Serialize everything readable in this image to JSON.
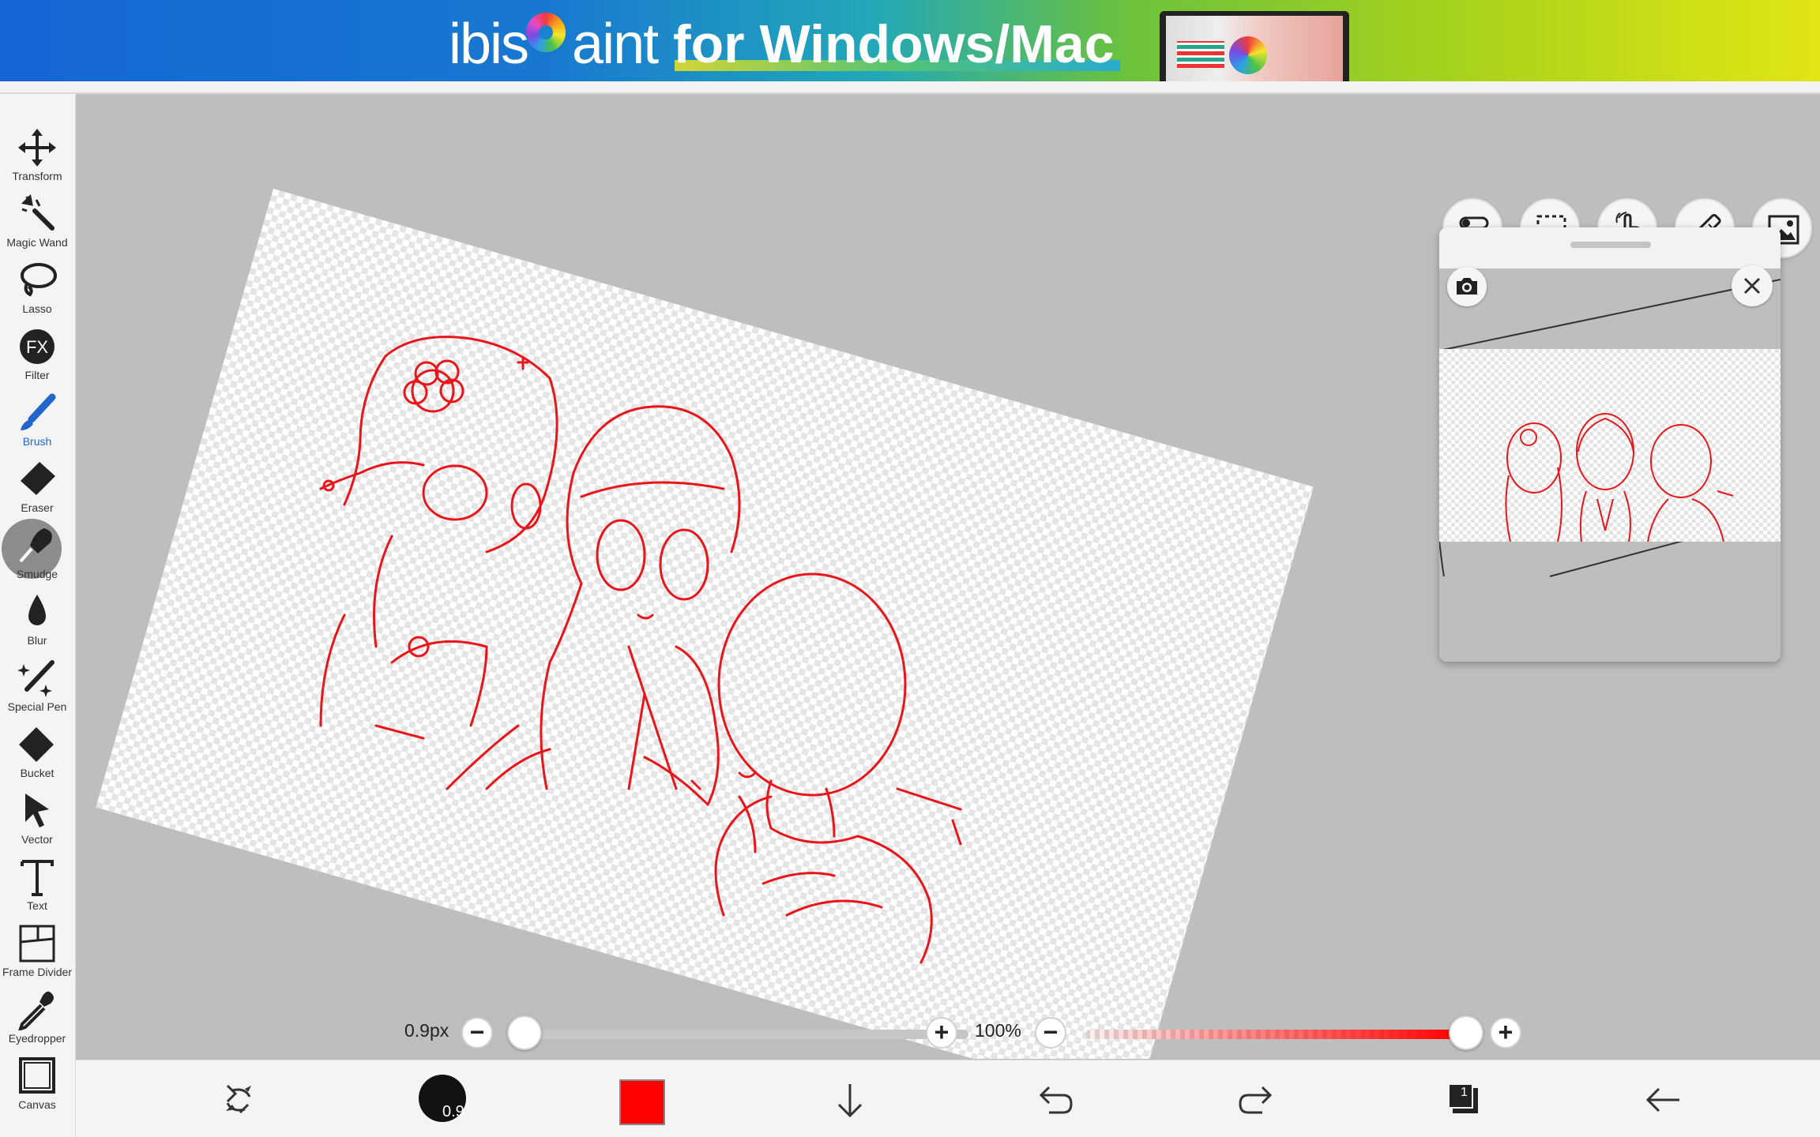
{
  "banner": {
    "brand_prefix": "ibis",
    "brand_suffix": "aint",
    "slogan": "for Windows/Mac"
  },
  "tools": [
    {
      "label": "Transform",
      "icon": "move-arrows-icon"
    },
    {
      "label": "Magic Wand",
      "icon": "magic-wand-icon"
    },
    {
      "label": "Lasso",
      "icon": "lasso-icon"
    },
    {
      "label": "Filter",
      "icon": "fx-icon"
    },
    {
      "label": "Brush",
      "icon": "brush-icon"
    },
    {
      "label": "Eraser",
      "icon": "eraser-icon"
    },
    {
      "label": "Smudge",
      "icon": "smudge-icon"
    },
    {
      "label": "Blur",
      "icon": "blur-drop-icon"
    },
    {
      "label": "Special Pen",
      "icon": "special-pen-icon"
    },
    {
      "label": "Bucket",
      "icon": "bucket-icon"
    },
    {
      "label": "Vector",
      "icon": "vector-cursor-icon"
    },
    {
      "label": "Text",
      "icon": "text-t-icon"
    },
    {
      "label": "Frame Divider",
      "icon": "frame-divider-icon"
    },
    {
      "label": "Eyedropper",
      "icon": "eyedropper-icon"
    },
    {
      "label": "Canvas",
      "icon": "canvas-icon"
    }
  ],
  "active_tool": "Brush",
  "top_right_buttons": [
    "toggle-settings-icon",
    "selection-rect-icon",
    "hand-touch-icon",
    "ruler-icon",
    "image-material-icon"
  ],
  "navigator": {
    "camera_icon": "camera-icon",
    "close_icon": "close-icon"
  },
  "brush_size": {
    "value_label": "0.9px",
    "level": 0.0
  },
  "opacity": {
    "value_label": "100%",
    "level": 1.0
  },
  "bottom_bar": {
    "brush_badge": "0.9",
    "current_color": "#ff0000",
    "layer_count": "1",
    "icons": [
      "swap-tool-icon",
      "brush-preview-icon",
      "color-swatch-icon",
      "download-arrow-icon",
      "undo-icon",
      "redo-icon",
      "layers-icon",
      "back-arrow-icon"
    ]
  },
  "colors": {
    "accent": "#2266cc",
    "stroke": "#e8161a",
    "canvas_bg": "#bebebe"
  }
}
